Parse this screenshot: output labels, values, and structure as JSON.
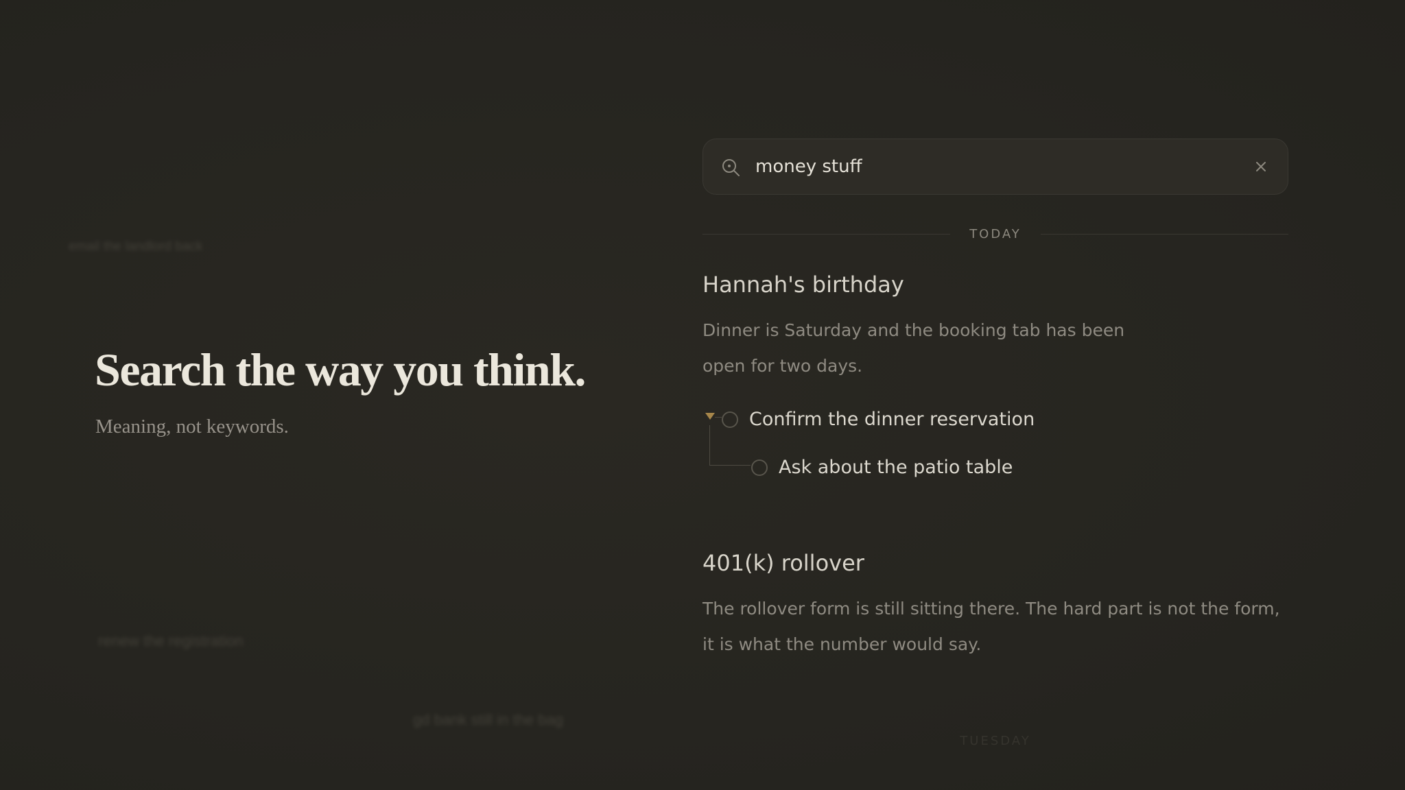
{
  "ghosts": {
    "hint_1": "email the landlord back",
    "hint_2": "renew the registration",
    "hint_3": "gd bank still in the bag"
  },
  "hero": {
    "title": "Search the way you think.",
    "subtitle": "Meaning, not keywords."
  },
  "search": {
    "value": "money stuff",
    "icon": "search-icon",
    "clear_icon": "close-icon"
  },
  "groups": [
    {
      "label": "TODAY",
      "results": [
        {
          "title": "Hannah's birthday",
          "body": "Dinner is Saturday and the booking tab has been open for two days.",
          "tasks": [
            {
              "label": "Confirm the dinner reservation"
            },
            {
              "label": "Ask about the patio table"
            }
          ]
        },
        {
          "title": "401(k) rollover",
          "body": "The rollover form is still sitting there. The hard part is not the form, it is what the number would say."
        }
      ]
    },
    {
      "label": "TUESDAY"
    }
  ],
  "colors": {
    "background": "#28261f",
    "accent": "#a6864a",
    "title_text": "#ebe7dc",
    "muted_text": "#8f8b82"
  }
}
